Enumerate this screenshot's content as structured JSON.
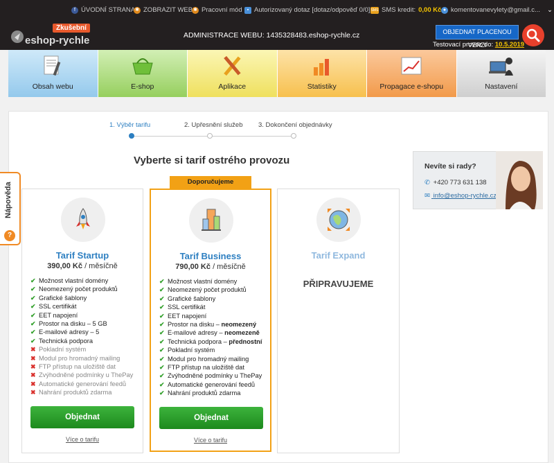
{
  "topbar": {
    "links": [
      {
        "label": "ÚVODNÍ STRANA",
        "icon": "facebook-icon"
      },
      {
        "label": "ZOBRAZIT WEB",
        "icon": "sun-icon"
      },
      {
        "label": "Pracovní mód",
        "icon": "sun-icon"
      },
      {
        "label": "Autorizovaný dotaz [dotaz/odpověď 0/0]",
        "icon": "chat-icon"
      }
    ],
    "sms_label": "SMS kredit:",
    "sms_value": "0,00 Kč",
    "sms_badge": "SMS",
    "user": "komentovanevylety@gmail.c..."
  },
  "header": {
    "badge": "Zkušební",
    "logo_text": "eshop-rychle",
    "admin_label": "ADMINISTRACE WEBU: 1435328483.eshop-rychle.cz",
    "order_button": "OBJEDNAT PLACENOU VERZI",
    "test_label": "Testovací provoz do:",
    "test_date": "10.5.2019"
  },
  "nav": {
    "tiles": [
      {
        "label": "Obsah webu",
        "color": "#a9d6f2"
      },
      {
        "label": "E-shop",
        "color": "#a8d977"
      },
      {
        "label": "Aplikace",
        "color": "#f4ea7c"
      },
      {
        "label": "Statistiky",
        "color": "#f9cd6d"
      },
      {
        "label": "Propagace e-shopu",
        "color": "#f5a65a"
      },
      {
        "label": "Nastavení",
        "color": "#e2e2e2"
      }
    ]
  },
  "steps": [
    "1. Výběr tarifu",
    "2. Upřesnění služeb",
    "3. Dokončení objednávky"
  ],
  "title": "Vyberte si tarif ostrého provozu",
  "recommended": "Doporučujeme",
  "plans": {
    "startup": {
      "name": "Tarif Startup",
      "price": "390,00 Kč",
      "period": "/ měsíčně",
      "features": [
        {
          "text": "Možnost vlastní domény",
          "ok": true
        },
        {
          "text": "Neomezený počet produktů",
          "ok": true
        },
        {
          "text": "Grafické šablony",
          "ok": true
        },
        {
          "text": "SSL certifikát",
          "ok": true
        },
        {
          "text": "EET napojení",
          "ok": true
        },
        {
          "text": "Prostor na disku – 5 GB",
          "ok": true
        },
        {
          "text": "E-mailové adresy – 5",
          "ok": true
        },
        {
          "text": "Technická podpora",
          "ok": true
        },
        {
          "text": "Pokladní systém",
          "ok": false
        },
        {
          "text": "Modul pro hromadný mailing",
          "ok": false
        },
        {
          "text": "FTP přístup na uložiště dat",
          "ok": false
        },
        {
          "text": "Zvýhodněné podmínky u ThePay",
          "ok": false
        },
        {
          "text": "Automatické generování feedů",
          "ok": false
        },
        {
          "text": "Nahrání produktů zdarma",
          "ok": false
        }
      ],
      "button": "Objednat",
      "more": "Více o tarifu"
    },
    "business": {
      "name": "Tarif Business",
      "price": "790,00 Kč",
      "period": "/ měsíčně",
      "features": [
        {
          "text": "Možnost vlastní domény",
          "bold": ""
        },
        {
          "text": "Neomezený počet produktů",
          "bold": ""
        },
        {
          "text": "Grafické šablony",
          "bold": ""
        },
        {
          "text": "SSL certifikát",
          "bold": ""
        },
        {
          "text": "EET napojení",
          "bold": ""
        },
        {
          "text": "Prostor na disku – ",
          "bold": "neomezený"
        },
        {
          "text": "E-mailové adresy – ",
          "bold": "neomezeně"
        },
        {
          "text": "Technická podpora – ",
          "bold": "přednostní"
        },
        {
          "text": "Pokladní systém",
          "bold": ""
        },
        {
          "text": "Modul pro hromadný mailing",
          "bold": ""
        },
        {
          "text": "FTP přístup na uložiště dat",
          "bold": ""
        },
        {
          "text": "Zvýhodněné podmínky u ThePay",
          "bold": ""
        },
        {
          "text": "Automatické generování feedů",
          "bold": ""
        },
        {
          "text": "Nahrání produktů zdarma",
          "bold": ""
        }
      ],
      "button": "Objednat",
      "more": "Více o tarifu"
    },
    "expand": {
      "name": "Tarif Expand",
      "status": "PŘIPRAVUJEME"
    }
  },
  "advice": {
    "heading": "Nevíte si rady?",
    "phone": "+420 773 631 138",
    "email": "info@eshop-rychle.cz"
  },
  "help": {
    "label": "Nápověda",
    "icon_text": "?"
  },
  "colors": {
    "accent_blue": "#2d7fc1",
    "orange": "#f2a115",
    "green": "#2ea12d",
    "dark": "#231f20"
  }
}
